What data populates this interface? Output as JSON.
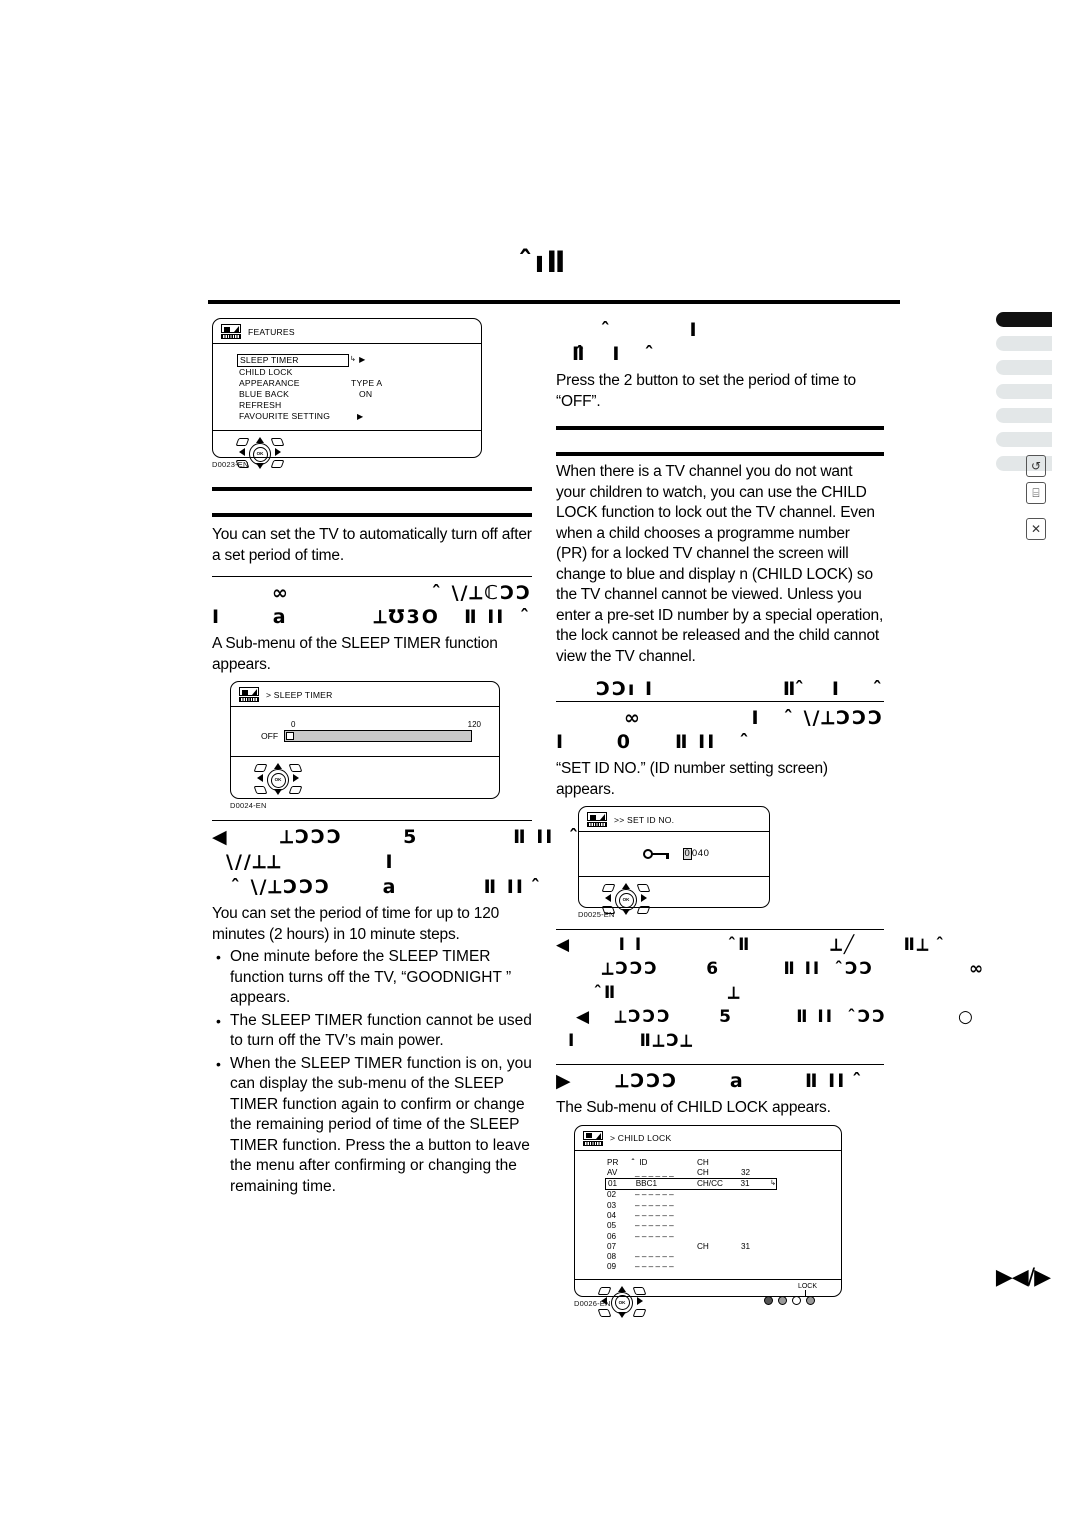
{
  "page": {
    "title_glyphs": "̂ıⅡ",
    "page_mark": "▶◀/▶"
  },
  "left_column": {
    "sleep_timer_menu": {
      "caption": "D0023-EN",
      "header": "FEATURES",
      "rows": [
        {
          "label": "SLEEP TIMER",
          "value": "",
          "arrow": "▶",
          "selected": true,
          "cursor": "↳"
        },
        {
          "label": "CHILD LOCK",
          "value": "",
          "arrow": "",
          "selected": false
        },
        {
          "label": "APPEARANCE",
          "value": "TYPE A",
          "arrow": "",
          "selected": false
        },
        {
          "label": "BLUE BACK",
          "value": "ON",
          "arrow": "",
          "selected": false
        },
        {
          "label": "REFRESH",
          "value": "",
          "arrow": "",
          "selected": false
        },
        {
          "label": "FAVOURITE SETTING",
          "value": "",
          "arrow": "▶",
          "selected": false
        }
      ]
    },
    "intro": "You can set the TV to automatically turn off after a set period of time.",
    "step1": {
      "glyph_top_mid": "∞",
      "glyph_top_right": "̂ \\/⟂ℂƆƆ",
      "glyph_line": "I      a          ⟂℧3Օ   Ⅱ II   ̂",
      "text": "A Sub-menu of the SLEEP TIMER function appears."
    },
    "sleep_timer_screen": {
      "caption": "D0024-EN",
      "header": "> SLEEP TIMER",
      "scale_min": "0",
      "scale_max": "120",
      "value_label": "OFF"
    },
    "step2": {
      "glyph_l1": "◀      ⟂ƆƆƆ       5           Ⅱ II   ̂ƆƆ   ƆƆı I",
      "glyph_l2": "\\//⟂⟂            I",
      "glyph_l3": "̂ \\/⟂ƆƆƆ      a          Ⅱ II  ̂",
      "text": "You can set the period of time for up to 120 minutes (2 hours) in 10 minute steps.",
      "bullets": [
        "One minute before the SLEEP TIMER function turns off the TV, “GOODNIGHT ” appears.",
        "The SLEEP TIMER function cannot be used to turn off the TV’s main power.",
        "When the SLEEP TIMER function is on, you can display the sub-menu of the SLEEP TIMER function again to confirm or change the remaining period of time of the SLEEP TIMER function. Press the a    button to leave the menu after confirming or changing the remaining time."
      ]
    }
  },
  "right_column": {
    "note_head": {
      "glyph_l1": "̂         I",
      "glyph_l2": "Ⅱ̂   I    ̂"
    },
    "note_text": "Press the 2  button to set the period of time to “OFF”.",
    "child_lock_head_glyphs": "",
    "child_lock_intro": "When there is a TV channel you do not want your children to watch, you can use the CHILD LOCK function to lock out the TV channel. Even when a child chooses a programme number (PR) for a locked TV channel the screen will change to blue and display n (CHILD LOCK) so the TV channel cannot be viewed. Unless you enter a pre-set ID number by a special operation, the lock cannot be released and the child cannot view the TV channel.",
    "section_head": {
      "left": "ƆƆı I",
      "right": "Ⅱ ̂   I     ̂"
    },
    "step1": {
      "glyph_top_mid": "∞",
      "glyph_top_right": "I    ̂ \\/⟂ƆƆƆ",
      "glyph_line": "I      0     Ⅱ II    ̂",
      "text": "“SET ID NO.” (ID number setting screen) appears."
    },
    "set_id_screen": {
      "caption": "D0025-EN",
      "header": ">> SET ID NO.",
      "id_first_digit": "0",
      "id_rest": "040"
    },
    "step2": {
      "glyph_l1": "◀      I I            ̂Ⅱ          ⟂╱      Ⅱ⟂  ̂",
      "glyph_l2": "⟂ƆƆƆ      6        Ⅱ II   ̂ƆƆ            ∞",
      "glyph_l3": "̂Ⅱ              ⟂",
      "glyph_l4": "◀   ⟂ƆƆƆ      5        Ⅱ II   ̂ƆƆ         ○",
      "glyph_l5": "I        Ⅱ⟂Ɔ⟂"
    },
    "step3": {
      "glyph_line": "▶     ⟂ƆƆƆ      a       Ⅱ II  ̂",
      "text": "The Sub-menu of CHILD LOCK appears."
    },
    "child_lock_screen": {
      "caption": "D0026-EN",
      "header": "> CHILD LOCK",
      "columns": [
        "PR",
        "ID",
        "CH",
        ""
      ],
      "lock_icon": "̂",
      "rows": [
        {
          "pr": "PR",
          "id": "ID",
          "ch": "CH",
          "num": "",
          "header": true
        },
        {
          "pr": "AV",
          "id": "_ _ _ _ _ _",
          "ch": "CH",
          "num": "32",
          "header": false
        },
        {
          "pr": "01",
          "id": "BBC1",
          "ch": "CH/CC",
          "num": "31",
          "header": false,
          "selected": true,
          "cursor": "↳"
        },
        {
          "pr": "02",
          "id": "– – – – – –",
          "ch": "",
          "num": ""
        },
        {
          "pr": "03",
          "id": "– – – – – –",
          "ch": "",
          "num": ""
        },
        {
          "pr": "04",
          "id": "– – – – – –",
          "ch": "",
          "num": ""
        },
        {
          "pr": "05",
          "id": "– – – – – –",
          "ch": "",
          "num": ""
        },
        {
          "pr": "06",
          "id": "– – – – – –",
          "ch": "",
          "num": ""
        },
        {
          "pr": "07",
          "id": "",
          "ch": "CH",
          "num": "31"
        },
        {
          "pr": "08",
          "id": "– – – – – –",
          "ch": "",
          "num": ""
        },
        {
          "pr": "09",
          "id": "– – – – – –",
          "ch": "",
          "num": ""
        }
      ],
      "lock_label": "LOCK"
    }
  },
  "side_tabs": {
    "count": 7,
    "active_index": 0,
    "icons": [
      "rotate-icon",
      "keyboard-icon",
      "close-icon"
    ],
    "icon_glyphs": [
      "↺",
      "⌸",
      "✕"
    ]
  },
  "colors": {
    "tab_inactive": "#e3e7e8",
    "tab_active": "#111111",
    "slider_fill": "#c9c9c9",
    "ink": "#000000"
  }
}
